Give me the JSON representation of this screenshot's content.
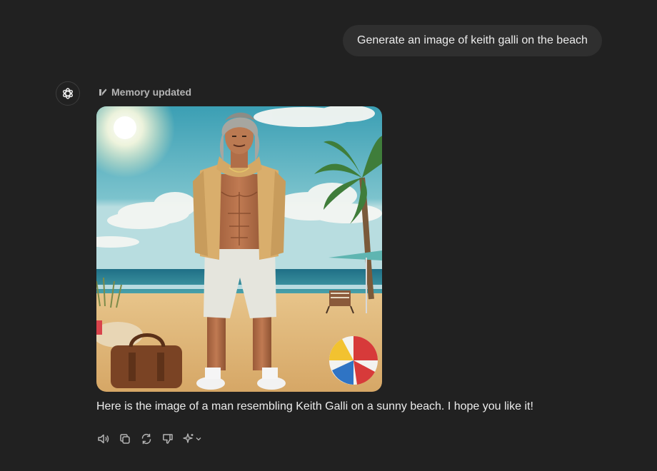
{
  "user_message": "Generate an image of keith galli on the beach",
  "assistant": {
    "avatar_icon": "openai-logo-icon",
    "memory_status": "Memory updated",
    "memory_icon": "memory-pencil-icon",
    "image_subject": "man resembling Keith Galli on a sunny beach",
    "reply": "Here is the image of a man resembling Keith Galli on a sunny beach. I hope you like it!"
  },
  "actions": [
    {
      "name": "read-aloud-button",
      "icon": "speaker-icon"
    },
    {
      "name": "copy-button",
      "icon": "copy-icon"
    },
    {
      "name": "regenerate-button",
      "icon": "refresh-icon"
    },
    {
      "name": "bad-response-button",
      "icon": "thumbs-down-icon"
    },
    {
      "name": "change-model-button",
      "icon": "sparkle-icon"
    }
  ],
  "colors": {
    "background": "#212121",
    "bubble": "#2f2f2f",
    "text": "#ececec",
    "muted": "#b4b4b4"
  }
}
